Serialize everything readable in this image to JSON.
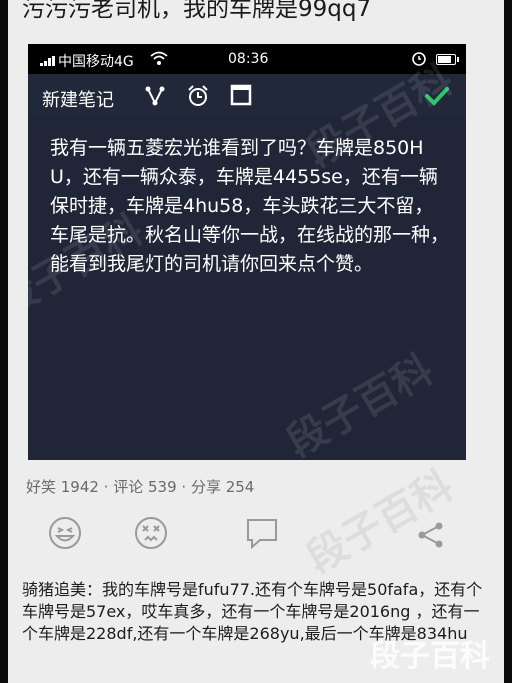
{
  "post": {
    "title": "污污污老司机，我的车牌是99qq7"
  },
  "status_bar": {
    "carrier": "中国移动4G",
    "time": "08:36"
  },
  "toolbar": {
    "title": "新建笔记",
    "icons": [
      "share-icon",
      "alarm-icon",
      "checkbox-icon",
      "check-icon"
    ],
    "accent_color": "#2fc36a"
  },
  "note": {
    "body": "我有一辆五菱宏光谁看到了吗？车牌是850HU，还有一辆众泰，车牌是4455se，还有一辆保时捷，车牌是4hu58，车头跌花三大不留，车尾是抗。秋名山等你一战，在线战的那一种，能看到我尾灯的司机请你回来点个赞。"
  },
  "stats": {
    "text": "好笑 1942 · 评论 539 · 分享 254"
  },
  "actions": [
    "laugh-icon",
    "dizzy-icon",
    "comment-icon",
    "share-icon"
  ],
  "comment": {
    "author": "骑猪追美：",
    "text": "我的车牌号是fufu77.还有个车牌号是50fafa，还有个车牌号是57ex，哎车真多，还有一个车牌号是2016ng ，还有一个车牌是228df,还有一个车牌是268yu,最后一个车牌是834hu"
  },
  "watermark": {
    "text": "段子百科"
  }
}
